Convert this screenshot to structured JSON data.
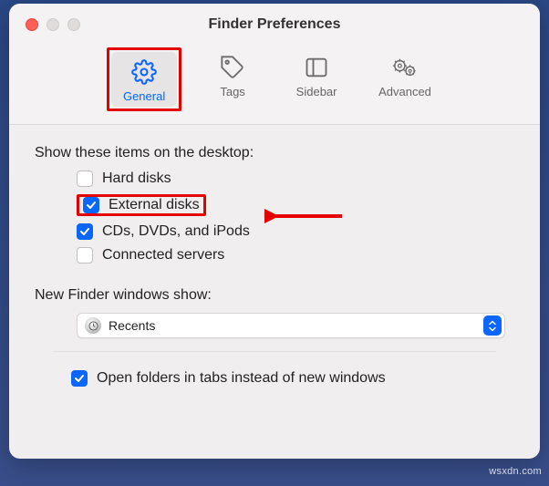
{
  "window": {
    "title": "Finder Preferences"
  },
  "tabs": {
    "general": "General",
    "tags": "Tags",
    "sidebar": "Sidebar",
    "advanced": "Advanced"
  },
  "section1": {
    "label": "Show these items on the desktop:"
  },
  "checks": {
    "hard_disks": "Hard disks",
    "external_disks": "External disks",
    "cds": "CDs, DVDs, and iPods",
    "connected": "Connected servers"
  },
  "section2": {
    "label": "New Finder windows show:"
  },
  "dropdown": {
    "value": "Recents"
  },
  "final": {
    "label": "Open folders in tabs instead of new windows"
  },
  "watermark": "wsxdn.com"
}
